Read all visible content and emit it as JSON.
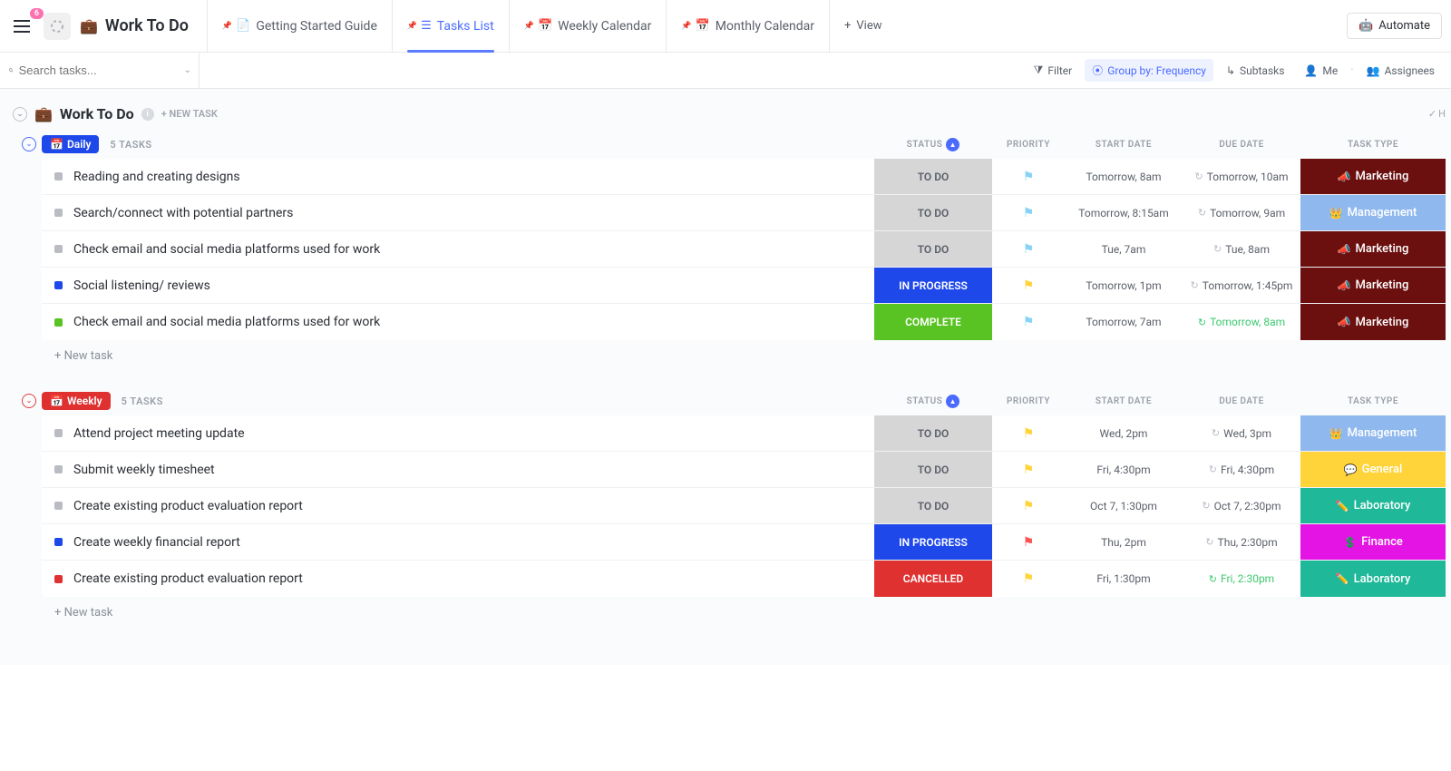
{
  "notif_count": "6",
  "workspace_title": "Work To Do",
  "views": [
    {
      "label": "Getting Started Guide",
      "icon": "doc",
      "active": false
    },
    {
      "label": "Tasks List",
      "icon": "list",
      "active": true
    },
    {
      "label": "Weekly Calendar",
      "icon": "cal",
      "active": false
    },
    {
      "label": "Monthly Calendar",
      "icon": "cal",
      "active": false
    }
  ],
  "add_view_label": "View",
  "automate_label": "Automate",
  "search_placeholder": "Search tasks...",
  "filters": {
    "filter": "Filter",
    "group_by": "Group by: Frequency",
    "subtasks": "Subtasks",
    "me": "Me",
    "assignees": "Assignees"
  },
  "section_title": "Work To Do",
  "new_task_label": "+ NEW TASK",
  "hide_label": "H",
  "columns": {
    "status": "STATUS",
    "priority": "PRIORITY",
    "start_date": "START DATE",
    "due_date": "DUE DATE",
    "task_type": "TASK TYPE"
  },
  "new_task_row": "+ New task",
  "status_colors": {
    "TO DO": {
      "bg": "#d6d6d6",
      "fg": "#5a5f69",
      "sq": "#b9bcc2"
    },
    "IN PROGRESS": {
      "bg": "#1f48ea",
      "fg": "#ffffff",
      "sq": "#1f48ea"
    },
    "COMPLETE": {
      "bg": "#58c322",
      "fg": "#ffffff",
      "sq": "#58c322"
    },
    "CANCELLED": {
      "bg": "#e03131",
      "fg": "#ffffff",
      "sq": "#e03131"
    }
  },
  "priority_colors": {
    "low": "#87d3f8",
    "normal": "#ffd43b",
    "high": "#fa5252"
  },
  "type_styles": {
    "Marketing": {
      "bg": "#6b0f0f",
      "icon": "📣"
    },
    "Management": {
      "bg": "#8fb8ee",
      "icon": "👑"
    },
    "General": {
      "bg": "#ffd43b",
      "icon": "💬"
    },
    "Laboratory": {
      "bg": "#1fb899",
      "icon": "✏️"
    },
    "Finance": {
      "bg": "#e415e4",
      "icon": "💲"
    }
  },
  "groups": [
    {
      "name": "Daily",
      "color": "blue",
      "count": "5 TASKS",
      "tasks": [
        {
          "name": "Reading and creating designs",
          "status": "TO DO",
          "priority": "low",
          "start": "Tomorrow, 8am",
          "due": "Tomorrow, 10am",
          "due_green": false,
          "type": "Marketing"
        },
        {
          "name": "Search/connect with potential partners",
          "status": "TO DO",
          "priority": "low",
          "start": "Tomorrow, 8:15am",
          "due": "Tomorrow, 9am",
          "due_green": false,
          "type": "Management"
        },
        {
          "name": "Check email and social media platforms used for work",
          "status": "TO DO",
          "priority": "low",
          "start": "Tue, 7am",
          "due": "Tue, 8am",
          "due_green": false,
          "type": "Marketing"
        },
        {
          "name": "Social listening/ reviews",
          "status": "IN PROGRESS",
          "priority": "normal",
          "start": "Tomorrow, 1pm",
          "due": "Tomorrow, 1:45pm",
          "due_green": false,
          "type": "Marketing"
        },
        {
          "name": "Check email and social media platforms used for work",
          "status": "COMPLETE",
          "priority": "low",
          "start": "Tomorrow, 7am",
          "due": "Tomorrow, 8am",
          "due_green": true,
          "type": "Marketing"
        }
      ]
    },
    {
      "name": "Weekly",
      "color": "red",
      "count": "5 TASKS",
      "tasks": [
        {
          "name": "Attend project meeting update",
          "status": "TO DO",
          "priority": "normal",
          "start": "Wed, 2pm",
          "due": "Wed, 3pm",
          "due_green": false,
          "type": "Management"
        },
        {
          "name": "Submit weekly timesheet",
          "status": "TO DO",
          "priority": "normal",
          "start": "Fri, 4:30pm",
          "due": "Fri, 4:30pm",
          "due_green": false,
          "type": "General"
        },
        {
          "name": "Create existing product evaluation report",
          "status": "TO DO",
          "priority": "normal",
          "start": "Oct 7, 1:30pm",
          "due": "Oct 7, 2:30pm",
          "due_green": false,
          "type": "Laboratory"
        },
        {
          "name": "Create weekly financial report",
          "status": "IN PROGRESS",
          "priority": "high",
          "start": "Thu, 2pm",
          "due": "Thu, 2:30pm",
          "due_green": false,
          "type": "Finance"
        },
        {
          "name": "Create existing product evaluation report",
          "status": "CANCELLED",
          "priority": "normal",
          "start": "Fri, 1:30pm",
          "due": "Fri, 2:30pm",
          "due_green": true,
          "type": "Laboratory"
        }
      ]
    }
  ]
}
